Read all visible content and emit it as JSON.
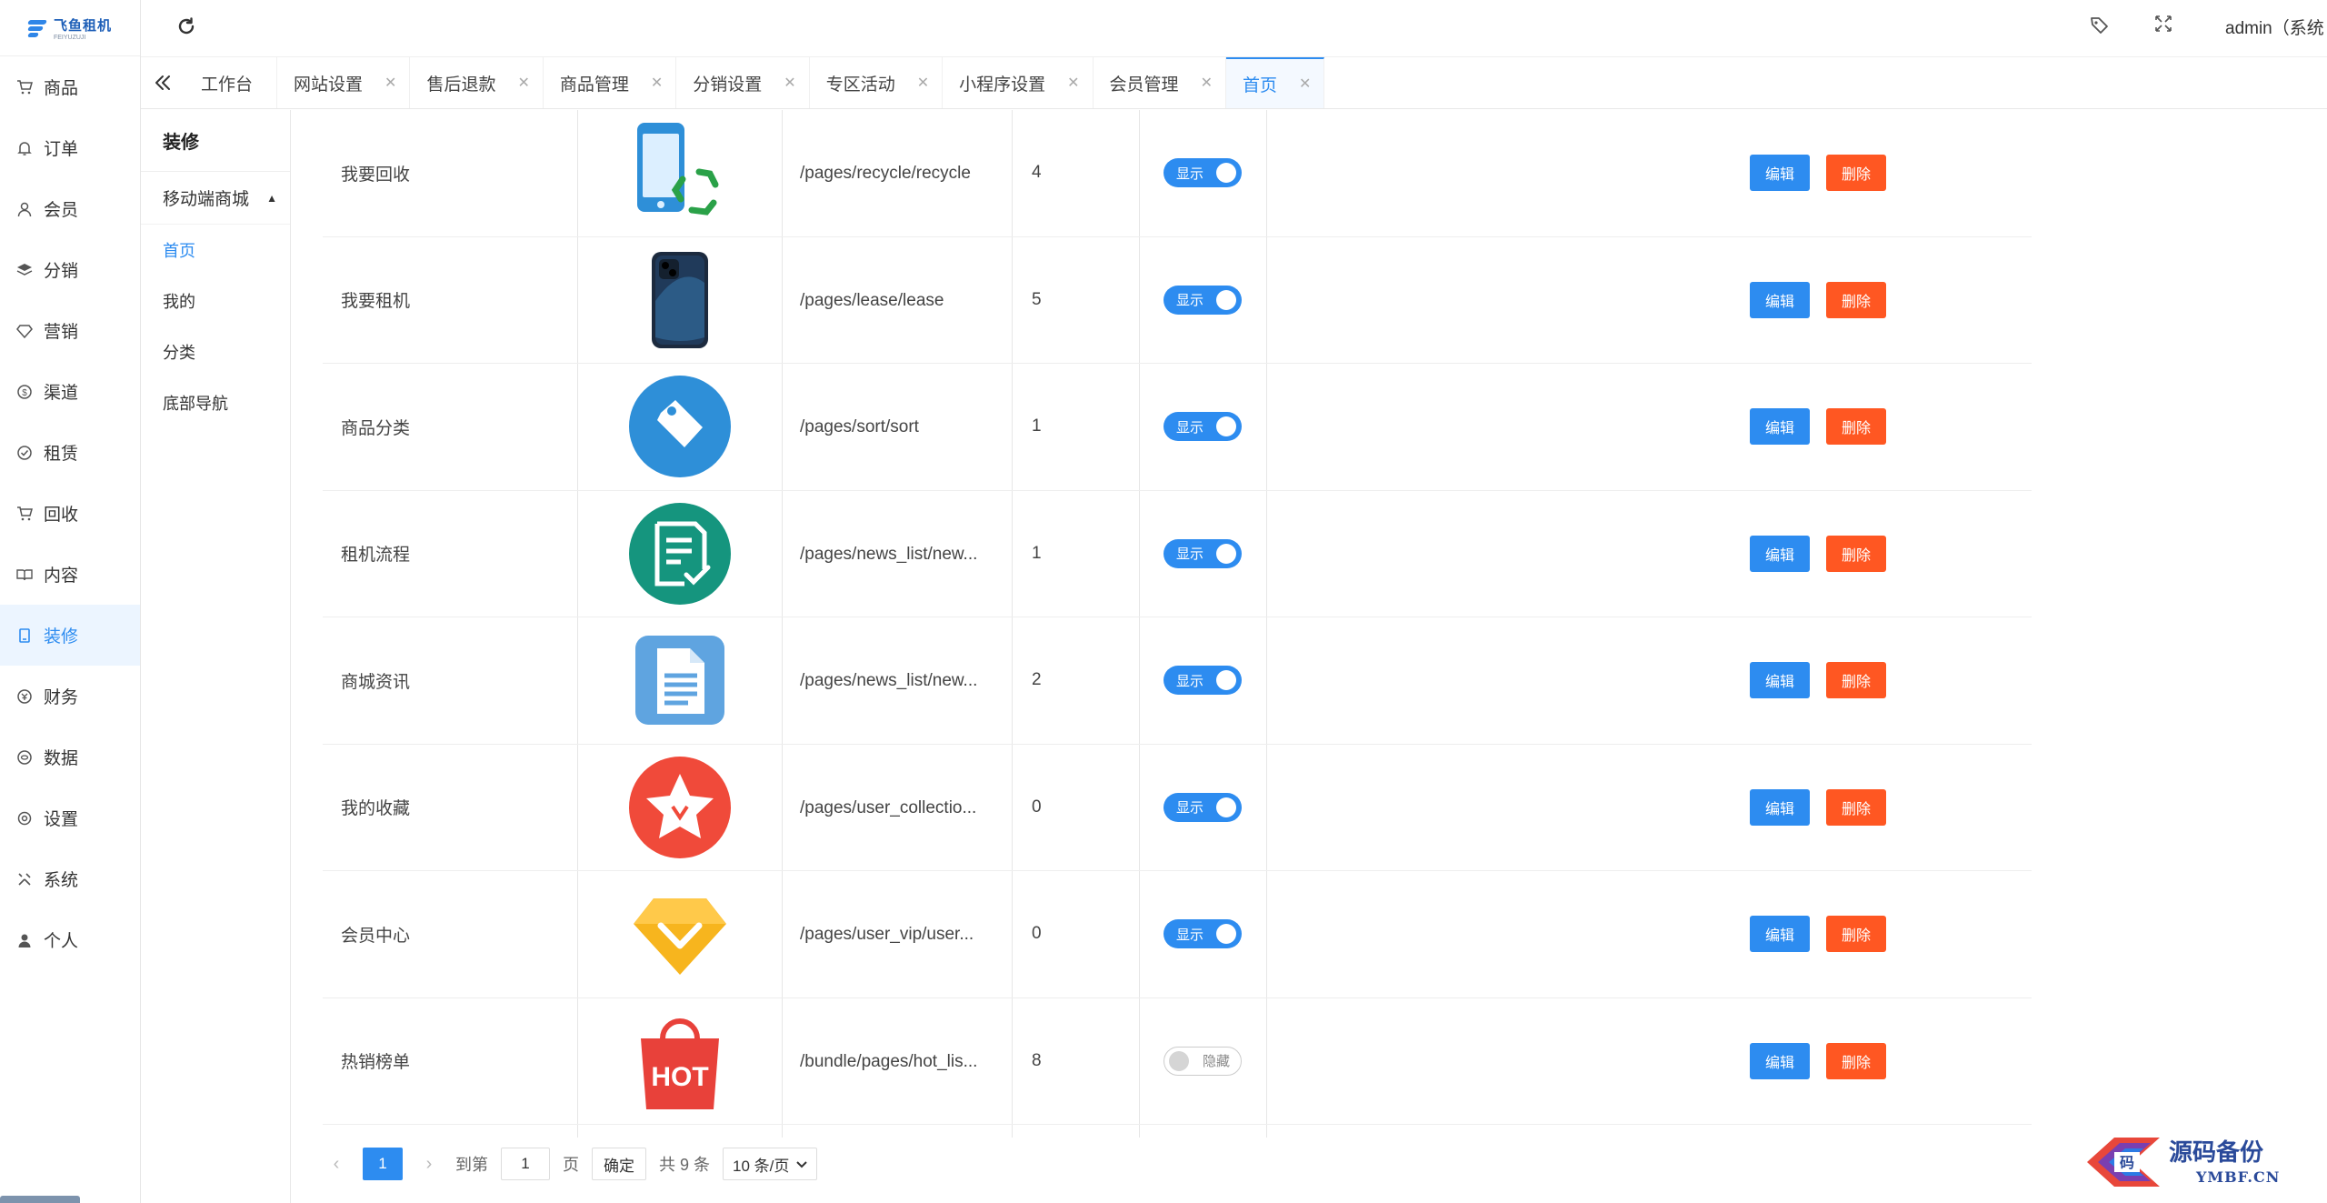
{
  "logo": {
    "title": "飞鱼租机",
    "subtitle": "FEIYUZUJI"
  },
  "sidebar": {
    "items": [
      {
        "label": "商品",
        "icon": "cart-icon"
      },
      {
        "label": "订单",
        "icon": "bell-icon"
      },
      {
        "label": "会员",
        "icon": "user-icon"
      },
      {
        "label": "分销",
        "icon": "layers-icon"
      },
      {
        "label": "营销",
        "icon": "diamond-icon"
      },
      {
        "label": "渠道",
        "icon": "coin-icon"
      },
      {
        "label": "租赁",
        "icon": "check-circle-icon"
      },
      {
        "label": "回收",
        "icon": "cart-icon"
      },
      {
        "label": "内容",
        "icon": "book-icon"
      },
      {
        "label": "装修",
        "icon": "tablet-icon",
        "active": true
      },
      {
        "label": "财务",
        "icon": "wallet-icon"
      },
      {
        "label": "数据",
        "icon": "database-icon"
      },
      {
        "label": "设置",
        "icon": "gear-icon"
      },
      {
        "label": "系统",
        "icon": "tools-icon"
      },
      {
        "label": "个人",
        "icon": "person-icon"
      }
    ]
  },
  "header": {
    "admin": "admin（系统"
  },
  "tabs": [
    {
      "label": "工作台",
      "closable": false
    },
    {
      "label": "网站设置",
      "closable": true
    },
    {
      "label": "售后退款",
      "closable": true
    },
    {
      "label": "商品管理",
      "closable": true
    },
    {
      "label": "分销设置",
      "closable": true
    },
    {
      "label": "专区活动",
      "closable": true
    },
    {
      "label": "小程序设置",
      "closable": true
    },
    {
      "label": "会员管理",
      "closable": true
    },
    {
      "label": "首页",
      "closable": true,
      "active": true
    }
  ],
  "submenu": {
    "title": "装修",
    "group": "移动端商城",
    "items": [
      "首页",
      "我的",
      "分类",
      "底部导航"
    ]
  },
  "rows": [
    {
      "name": "我要回收",
      "path": "/pages/recycle/recycle",
      "sort": "4",
      "status": "显示",
      "on": true,
      "img": "recycle-phone"
    },
    {
      "name": "我要租机",
      "path": "/pages/lease/lease",
      "sort": "5",
      "status": "显示",
      "on": true,
      "img": "iphone"
    },
    {
      "name": "商品分类",
      "path": "/pages/sort/sort",
      "sort": "1",
      "status": "显示",
      "on": true,
      "img": "tag"
    },
    {
      "name": "租机流程",
      "path": "/pages/news_list/new...",
      "sort": "1",
      "status": "显示",
      "on": true,
      "img": "checklist"
    },
    {
      "name": "商城资讯",
      "path": "/pages/news_list/new...",
      "sort": "2",
      "status": "显示",
      "on": true,
      "img": "document"
    },
    {
      "name": "我的收藏",
      "path": "/pages/user_collectio...",
      "sort": "0",
      "status": "显示",
      "on": true,
      "img": "star"
    },
    {
      "name": "会员中心",
      "path": "/pages/user_vip/user...",
      "sort": "0",
      "status": "显示",
      "on": true,
      "img": "vip"
    },
    {
      "name": "热销榜单",
      "path": "/bundle/pages/hot_lis...",
      "sort": "8",
      "status": "隐藏",
      "on": false,
      "img": "hot-bag"
    }
  ],
  "actions": {
    "edit": "编辑",
    "delete": "删除"
  },
  "pager": {
    "current": "1",
    "goto": "到第",
    "page_value": "1",
    "page_unit": "页",
    "confirm": "确定",
    "total": "共 9 条",
    "size": "10 条/页"
  },
  "watermark": {
    "title": "源码备份",
    "sub": "YMBF.CN"
  },
  "colors": {
    "primary": "#2d8cf0",
    "danger": "#ff5722"
  }
}
